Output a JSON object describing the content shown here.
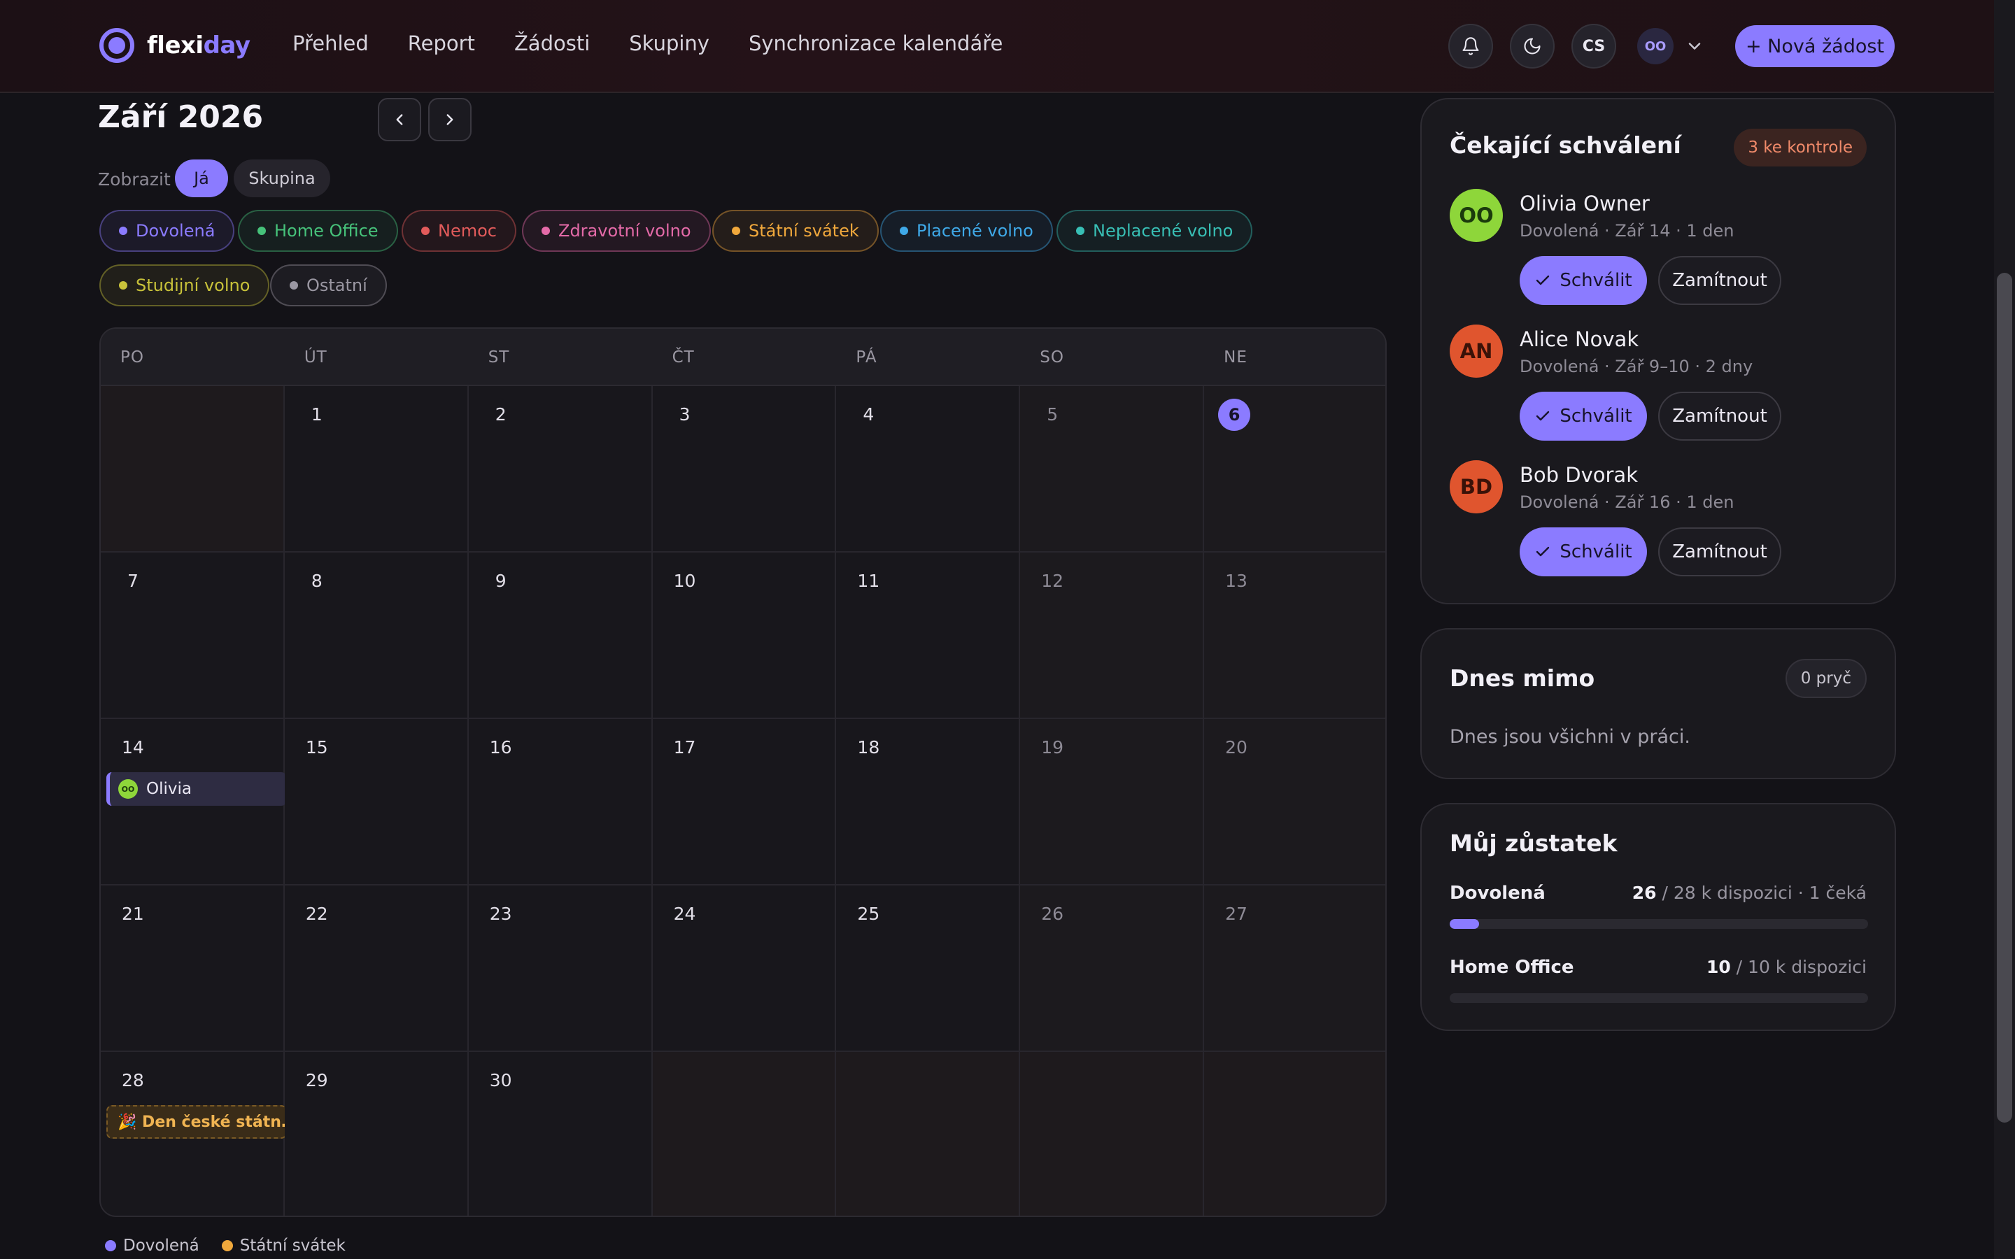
{
  "brand": {
    "name_part1": "flexi",
    "name_part2": "day",
    "accent": "#8b7bff"
  },
  "nav": {
    "items": [
      "Přehled",
      "Report",
      "Žádosti",
      "Skupiny",
      "Synchronizace kalendáře"
    ]
  },
  "header": {
    "lang": "CS",
    "user_initials": "OO",
    "new_request": "+ Nová žádost"
  },
  "calendar": {
    "month_title": "Září 2026",
    "view_label": "Zobrazit",
    "view_options": [
      "Já",
      "Skupina"
    ],
    "active_view": "Já",
    "filters": [
      {
        "label": "Dovolená",
        "color": "#8b7bff"
      },
      {
        "label": "Home Office",
        "color": "#46c27a"
      },
      {
        "label": "Nemoc",
        "color": "#e25b5b"
      },
      {
        "label": "Zdravotní volno",
        "color": "#e46aa8"
      },
      {
        "label": "Státní svátek",
        "color": "#f0a83c"
      },
      {
        "label": "Placené volno",
        "color": "#3fa9e8"
      },
      {
        "label": "Neplacené volno",
        "color": "#38bfb5"
      },
      {
        "label": "Studijní volno",
        "color": "#c8c23a"
      },
      {
        "label": "Ostatní",
        "color": "#9a97a2"
      }
    ],
    "weekdays": [
      "PO",
      "ÚT",
      "ST",
      "ČT",
      "PÁ",
      "SO",
      "NE"
    ],
    "today": "6",
    "weeks": [
      [
        "",
        "1",
        "2",
        "3",
        "4",
        "5",
        "6"
      ],
      [
        "7",
        "8",
        "9",
        "10",
        "11",
        "12",
        "13"
      ],
      [
        "14",
        "15",
        "16",
        "17",
        "18",
        "19",
        "20"
      ],
      [
        "21",
        "22",
        "23",
        "24",
        "25",
        "26",
        "27"
      ],
      [
        "28",
        "29",
        "30",
        "",
        "",
        "",
        ""
      ]
    ],
    "events": {
      "olivia": {
        "label": "Olivia",
        "initials": "OO"
      },
      "holiday": {
        "label": "🎉 Den české státn…"
      }
    },
    "legend": [
      {
        "label": "Dovolená",
        "color": "#8b7bff"
      },
      {
        "label": "Státní svátek",
        "color": "#f0a83c"
      }
    ]
  },
  "approvals": {
    "title": "Čekající schválení",
    "badge": "3 ke kontrole",
    "approve_label": "Schválit",
    "reject_label": "Zamítnout",
    "requests": [
      {
        "initials": "OO",
        "name": "Olivia Owner",
        "meta": "Dovolená · Zář 14 · 1 den",
        "bg": "#8ed63a",
        "fg": "#1b3a0c"
      },
      {
        "initials": "AN",
        "name": "Alice Novak",
        "meta": "Dovolená · Zář 9–10 · 2 dny",
        "bg": "#e0552e",
        "fg": "#3a1208"
      },
      {
        "initials": "BD",
        "name": "Bob Dvorak",
        "meta": "Dovolená · Zář 16 · 1 den",
        "bg": "#e0552e",
        "fg": "#3a1208"
      }
    ]
  },
  "away": {
    "title": "Dnes mimo",
    "badge": "0 pryč",
    "message": "Dnes jsou všichni v práci."
  },
  "balance": {
    "title": "Můj zůstatek",
    "items": [
      {
        "label": "Dovolená",
        "value": "26",
        "rest": " / 28 k dispozici",
        "extra": " · 1 čeká",
        "fill": 0.07
      },
      {
        "label": "Home Office",
        "value": "10",
        "rest": " / 10 k dispozici",
        "extra": "",
        "fill": 0
      }
    ]
  }
}
